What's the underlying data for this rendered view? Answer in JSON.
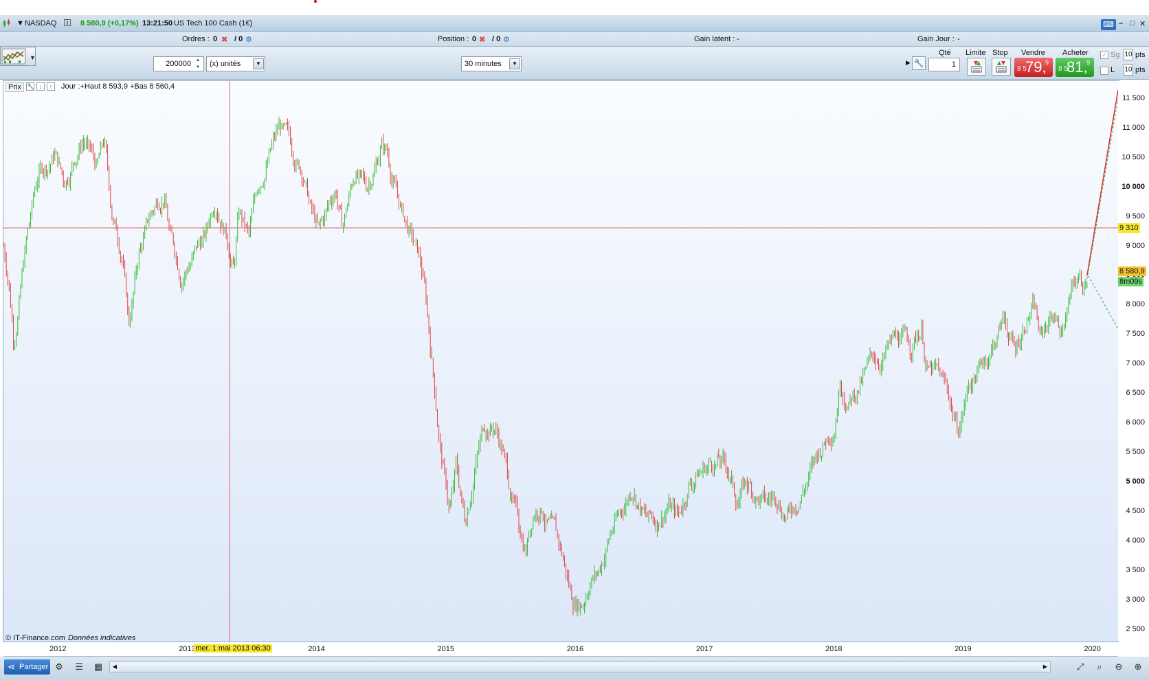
{
  "titlebar": {
    "exchange": "NASDAQ",
    "last_price": "8 580,9 (+0,17%)",
    "time": "13:21:50",
    "instrument": "US Tech 100 Cash (1€)",
    "info_icon": "i",
    "price_color": "#1a9a1a"
  },
  "orders_row": {
    "orders_label": "Ordres :",
    "orders_count": "0",
    "orders_total": "/ 0",
    "position_label": "Position :",
    "position_count": "0",
    "position_total": "/ 0",
    "gain_latent_label": "Gain latent :",
    "gain_latent_value": "-",
    "gain_jour_label": "Gain Jour :",
    "gain_jour_value": "-"
  },
  "controls": {
    "quantity_value": "200000",
    "units_value": "(x) unités",
    "timeframe_value": "30 minutes"
  },
  "trade_panel": {
    "qte_label": "Qté",
    "qte_value": "1",
    "limite_label": "Limite",
    "stop_label": "Stop",
    "vendre_label": "Vendre",
    "vendre_small": "8 5",
    "vendre_big": "79,",
    "vendre_sup": "9",
    "acheter_label": "Acheter",
    "acheter_small": "8 5",
    "acheter_big": "81,",
    "acheter_sup": "9",
    "sg_label": "Sg",
    "sg_value": "10",
    "sg_unit": "pts",
    "l_label": "L",
    "l_value": "10",
    "l_unit": "pts",
    "sell_color": "#d63232",
    "buy_color": "#2aa52a"
  },
  "chart_legend": {
    "prix_label": "Prix",
    "day_info": "Jour :+Haut 8 593,9 +Bas 8 560,4"
  },
  "copyright": {
    "source": "© IT-Finance.com",
    "note": "Données indicatives"
  },
  "y_axis": {
    "labels": [
      "11 500",
      "11 000",
      "10 500",
      "10 000",
      "9 500",
      "9 000",
      "8 500",
      "8 000",
      "7 500",
      "7 000",
      "6 500",
      "6 000",
      "5 500",
      "5 000",
      "4 500",
      "4 000",
      "3 500",
      "3 000",
      "2 500"
    ],
    "crosshair_tag": "9 310",
    "last_price_tag": "8 580,9",
    "countdown_tag": "8m09s"
  },
  "x_axis": {
    "labels": [
      "2012",
      "2013",
      "2014",
      "2015",
      "2016",
      "2017",
      "2018",
      "2019",
      "2020"
    ],
    "crosshair_tag": "mer. 1 mai 2013 06:30"
  },
  "bottom_bar": {
    "share_label": "Partager"
  },
  "chart_data": {
    "type": "candlestick",
    "x_unit": "year",
    "y_range": [
      2300,
      11800
    ],
    "x_range": [
      2011.58,
      2020.2
    ],
    "up_color": "#33bb33",
    "down_color": "#dd4444",
    "crosshair": {
      "x": 2013.33,
      "y": 9310
    },
    "last_price": 8580.9,
    "price_path": [
      [
        2011.58,
        9000
      ],
      [
        2011.62,
        8500
      ],
      [
        2011.66,
        7500
      ],
      [
        2011.75,
        9000
      ],
      [
        2011.85,
        10200
      ],
      [
        2011.98,
        10600
      ],
      [
        2012.05,
        10100
      ],
      [
        2012.15,
        10700
      ],
      [
        2012.2,
        10900
      ],
      [
        2012.3,
        10300
      ],
      [
        2012.36,
        10700
      ],
      [
        2012.42,
        9500
      ],
      [
        2012.5,
        8900
      ],
      [
        2012.55,
        7700
      ],
      [
        2012.63,
        8900
      ],
      [
        2012.72,
        9500
      ],
      [
        2012.82,
        10000
      ],
      [
        2012.87,
        9200
      ],
      [
        2012.95,
        8600
      ],
      [
        2013.05,
        8900
      ],
      [
        2013.15,
        9200
      ],
      [
        2013.22,
        9900
      ],
      [
        2013.3,
        9400
      ],
      [
        2013.36,
        8700
      ],
      [
        2013.4,
        9600
      ],
      [
        2013.48,
        9100
      ],
      [
        2013.55,
        10000
      ],
      [
        2013.62,
        10500
      ],
      [
        2013.72,
        11000
      ],
      [
        2013.8,
        10600
      ],
      [
        2013.9,
        10300
      ],
      [
        2013.96,
        9600
      ],
      [
        2014.02,
        9200
      ],
      [
        2014.06,
        9400
      ],
      [
        2014.15,
        10000
      ],
      [
        2014.2,
        9300
      ],
      [
        2014.3,
        10300
      ],
      [
        2014.38,
        9900
      ],
      [
        2014.47,
        10500
      ],
      [
        2014.5,
        10800
      ],
      [
        2014.55,
        10600
      ],
      [
        2014.6,
        10100
      ],
      [
        2014.66,
        9600
      ],
      [
        2014.74,
        9100
      ],
      [
        2014.8,
        8700
      ],
      [
        2014.84,
        8200
      ],
      [
        2014.92,
        6500
      ],
      [
        2014.96,
        5600
      ],
      [
        2015.03,
        4500
      ],
      [
        2015.08,
        5200
      ],
      [
        2015.15,
        4300
      ],
      [
        2015.22,
        5300
      ],
      [
        2015.3,
        6000
      ],
      [
        2015.38,
        6000
      ],
      [
        2015.44,
        5600
      ],
      [
        2015.5,
        4900
      ],
      [
        2015.57,
        4200
      ],
      [
        2015.62,
        3900
      ],
      [
        2015.68,
        4600
      ],
      [
        2015.74,
        4700
      ],
      [
        2015.82,
        4200
      ],
      [
        2015.9,
        3700
      ],
      [
        2015.98,
        3000
      ],
      [
        2016.06,
        3000
      ],
      [
        2016.12,
        3500
      ],
      [
        2016.18,
        3500
      ],
      [
        2016.28,
        4200
      ],
      [
        2016.36,
        4500
      ],
      [
        2016.45,
        5000
      ],
      [
        2016.55,
        4400
      ],
      [
        2016.62,
        4300
      ],
      [
        2016.72,
        4700
      ],
      [
        2016.8,
        4400
      ],
      [
        2016.88,
        5000
      ],
      [
        2016.95,
        5200
      ],
      [
        2017.02,
        5300
      ],
      [
        2017.1,
        5400
      ],
      [
        2017.18,
        5200
      ],
      [
        2017.25,
        4700
      ],
      [
        2017.32,
        5000
      ],
      [
        2017.4,
        4800
      ],
      [
        2017.48,
        4600
      ],
      [
        2017.56,
        4800
      ],
      [
        2017.65,
        4500
      ],
      [
        2017.75,
        4900
      ],
      [
        2017.85,
        5300
      ],
      [
        2017.95,
        5800
      ],
      [
        2018.0,
        6000
      ],
      [
        2018.05,
        6900
      ],
      [
        2018.12,
        6500
      ],
      [
        2018.2,
        6700
      ],
      [
        2018.3,
        7000
      ],
      [
        2018.4,
        7200
      ],
      [
        2018.5,
        7400
      ],
      [
        2018.6,
        7300
      ],
      [
        2018.68,
        7700
      ],
      [
        2018.72,
        7000
      ],
      [
        2018.8,
        6800
      ],
      [
        2018.88,
        6500
      ],
      [
        2018.96,
        5900
      ],
      [
        2019.05,
        6700
      ],
      [
        2019.12,
        6900
      ],
      [
        2019.22,
        7300
      ],
      [
        2019.32,
        7800
      ],
      [
        2019.4,
        7200
      ],
      [
        2019.5,
        7900
      ],
      [
        2019.55,
        8000
      ],
      [
        2019.6,
        7400
      ],
      [
        2019.7,
        7900
      ],
      [
        2019.76,
        7600
      ],
      [
        2019.84,
        8200
      ],
      [
        2019.9,
        8400
      ],
      [
        2019.93,
        8300
      ],
      [
        2019.96,
        8580
      ]
    ],
    "projection_lines": [
      {
        "color": "#dd3333",
        "style": "solid",
        "from": [
          2019.96,
          8500
        ],
        "to": [
          2020.2,
          11650
        ]
      },
      {
        "color": "#33aa33",
        "style": "dashed",
        "from": [
          2019.96,
          8450
        ],
        "to": [
          2020.2,
          11500
        ]
      },
      {
        "color": "#33aa33",
        "style": "dashed",
        "from": [
          2019.97,
          8500
        ],
        "to": [
          2020.2,
          7600
        ]
      }
    ]
  }
}
